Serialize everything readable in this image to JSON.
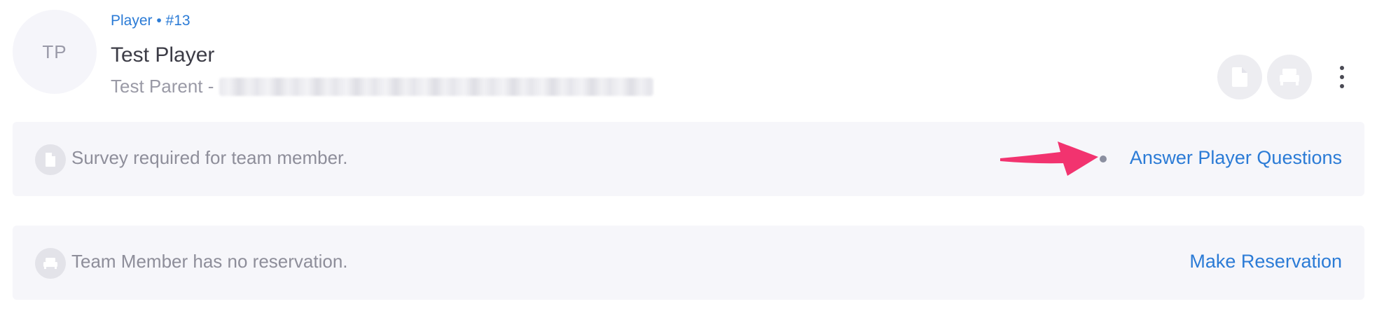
{
  "header": {
    "avatar_initials": "TP",
    "role_label": "Player • #13",
    "player_name": "Test Player",
    "parent_label": "Test Parent -"
  },
  "actions": {
    "survey_icon": "document-icon",
    "reservation_icon": "bed-icon",
    "more_icon": "kebab-menu-icon"
  },
  "notices": {
    "survey": {
      "message": "Survey required for team member.",
      "action_label": "Answer Player Questions",
      "icon": "document-icon"
    },
    "reservation": {
      "message": "Team Member has no reservation.",
      "action_label": "Make Reservation",
      "icon": "bed-icon"
    }
  },
  "colors": {
    "link": "#2b7bd6",
    "annotation_arrow": "#f2336f",
    "card_bg": "#f6f6fa"
  }
}
